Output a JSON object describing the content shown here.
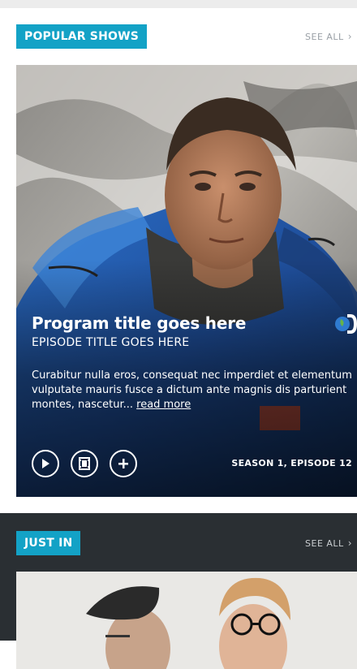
{
  "popular": {
    "tag": "POPULAR SHOWS",
    "see_all": "SEE ALL",
    "card": {
      "program_title": "Program title goes here",
      "episode_title": "EPISODE TITLE GOES HERE",
      "description": "Curabitur nulla eros, consequat nec imperdiet et elementum vulputate mauris fusce a dictum ante magnis dis parturient montes, nascetur...",
      "read_more": "read more",
      "season_episode": "SEASON 1, EPISODE 12",
      "actions": [
        "play-icon",
        "film-icon",
        "plus-icon"
      ]
    }
  },
  "just_in": {
    "tag": "JUST IN",
    "see_all": "SEE ALL"
  },
  "colors": {
    "accent": "#13a2c6",
    "dark_band": "#2a2f33"
  }
}
